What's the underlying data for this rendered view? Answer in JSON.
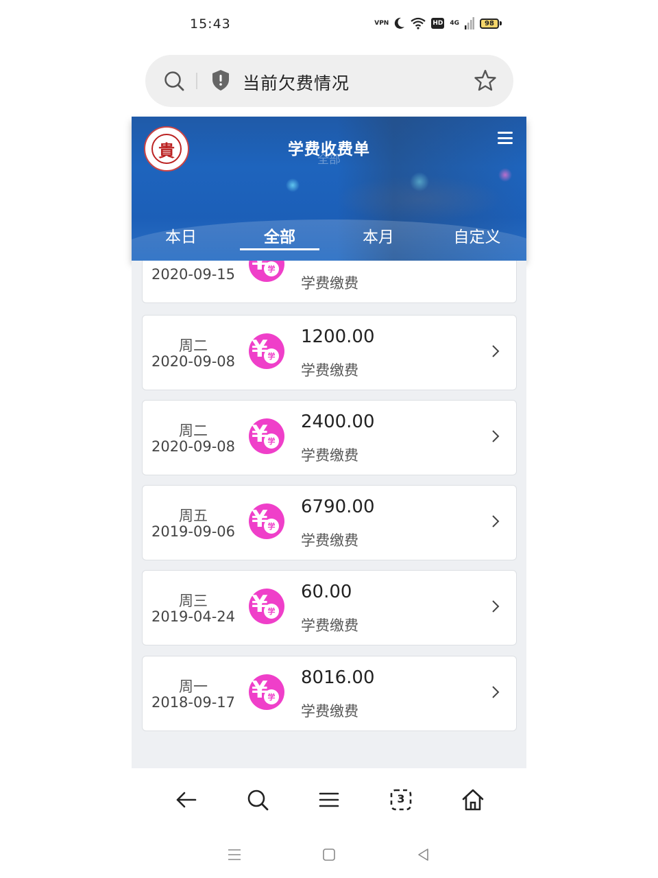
{
  "status_bar": {
    "time": "15:43",
    "vpn": "VPN",
    "hd": "HD",
    "network": "4G",
    "battery": "98"
  },
  "address_bar": {
    "title": "当前欠费情况"
  },
  "header": {
    "title": "学费收费单",
    "subtitle": "全部",
    "logo_char": "貴"
  },
  "tabs": [
    {
      "label": "本日",
      "active": false
    },
    {
      "label": "全部",
      "active": true
    },
    {
      "label": "本月",
      "active": false
    },
    {
      "label": "自定义",
      "active": false
    }
  ],
  "records": [
    {
      "weekday": "",
      "date": "2020-09-15",
      "amount": "",
      "desc": "学费缴费"
    },
    {
      "weekday": "周二",
      "date": "2020-09-08",
      "amount": "1200.00",
      "desc": "学费缴费"
    },
    {
      "weekday": "周二",
      "date": "2020-09-08",
      "amount": "2400.00",
      "desc": "学费缴费"
    },
    {
      "weekday": "周五",
      "date": "2019-09-06",
      "amount": "6790.00",
      "desc": "学费缴费"
    },
    {
      "weekday": "周三",
      "date": "2019-04-24",
      "amount": "60.00",
      "desc": "学费缴费"
    },
    {
      "weekday": "周一",
      "date": "2018-09-17",
      "amount": "8016.00",
      "desc": "学费缴费"
    }
  ],
  "icon_text": {
    "yen": "¥",
    "xue": "学"
  },
  "bottom_nav": {
    "tab_count": "3"
  },
  "colors": {
    "accent_pink": "#ef3fc9",
    "header_blue": "#1e64bd",
    "list_bg": "#eef0f3"
  }
}
